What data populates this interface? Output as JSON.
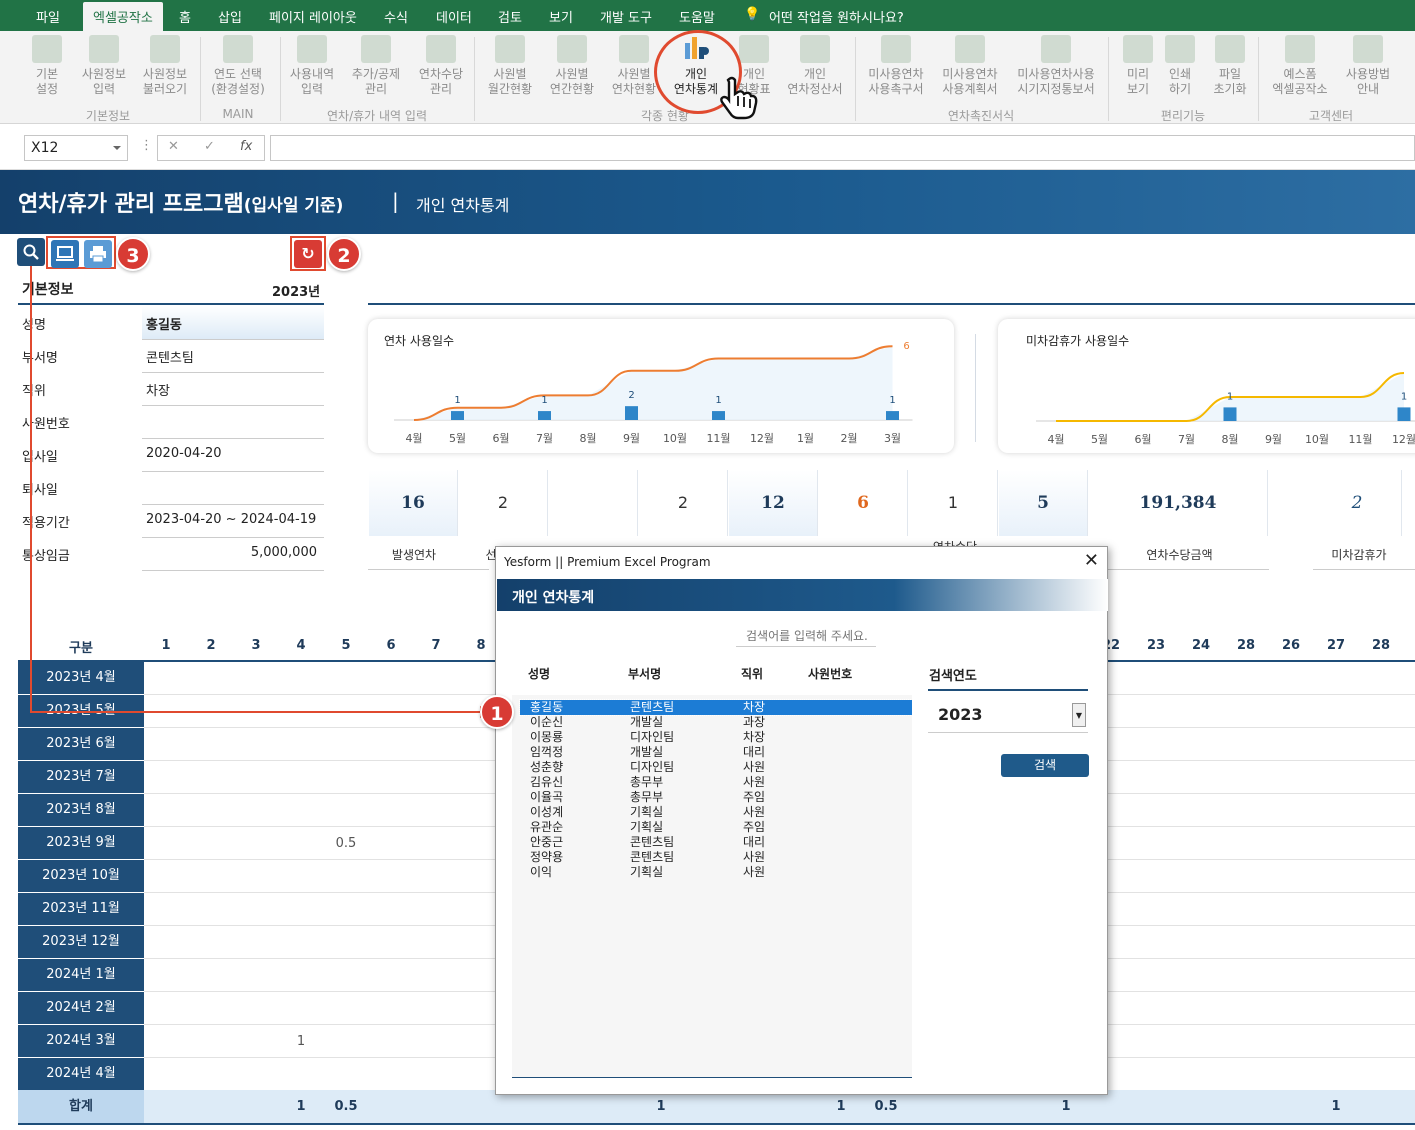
{
  "menu": {
    "tabs": [
      "파일",
      "엑셀공작소",
      "홈",
      "삽입",
      "페이지 레이아웃",
      "수식",
      "데이터",
      "검토",
      "보기",
      "개발 도구",
      "도움말"
    ],
    "tell_me": "어떤 작업을 원하시나요?"
  },
  "ribbon": {
    "buttons": [
      {
        "label": "기본\n설정",
        "icon": "gear-icon"
      },
      {
        "label": "사원정보\n입력",
        "icon": "users-icon"
      },
      {
        "label": "사원정보\n불러오기",
        "icon": "import-icon"
      },
      {
        "label": "연도 선택\n(환경설정)",
        "icon": "grid-icon"
      },
      {
        "label": "사용내역\n입력",
        "icon": "edit-list-icon"
      },
      {
        "label": "추가/공제\n관리",
        "icon": "list-edit-icon"
      },
      {
        "label": "연차수당\n관리",
        "icon": "list-edit-icon"
      },
      {
        "label": "사원별\n월간현황",
        "icon": "table-icon"
      },
      {
        "label": "사원별\n연간현황",
        "icon": "table-icon"
      },
      {
        "label": "사원별\n연차현황",
        "icon": "table-plus-icon"
      },
      {
        "label": "개인\n연차통계",
        "icon": "chart-user-icon"
      },
      {
        "label": "개인\n현황표",
        "icon": "table-check-icon"
      },
      {
        "label": "개인\n연차정산서",
        "icon": "card-icon"
      },
      {
        "label": "미사용연차\n사용촉구서",
        "icon": "clipboard-icon"
      },
      {
        "label": "미사용연차\n사용계획서",
        "icon": "clipboard-icon"
      },
      {
        "label": "미사용연차사용\n시기지정통보서",
        "icon": "clipboard-icon"
      },
      {
        "label": "미리\n보기",
        "icon": "preview-icon"
      },
      {
        "label": "인쇄\n하기",
        "icon": "printer-icon"
      },
      {
        "label": "파일\n초기화",
        "icon": "trash-icon"
      },
      {
        "label": "예스폼\n엑셀공작소",
        "icon": "logo-icon"
      },
      {
        "label": "사용방법\n안내",
        "icon": "info-icon"
      }
    ],
    "groups": [
      "기본정보",
      "MAIN",
      "연차/휴가 내역 입력",
      "각종 현황",
      "연차촉진서식",
      "편리기능",
      "고객센터"
    ]
  },
  "formula_bar": {
    "name_box": "X12",
    "fx": "fx"
  },
  "header": {
    "title": "연차/휴가 관리 프로그램",
    "subtitle": "(입사일 기준)",
    "sep": "|",
    "page": "개인 연차통계"
  },
  "badges": [
    "1",
    "2",
    "3"
  ],
  "basic_info": {
    "title": "기본정보",
    "year": "2023년",
    "rows": [
      {
        "label": "성명",
        "value": "홍길동"
      },
      {
        "label": "부서명",
        "value": "콘텐츠팀"
      },
      {
        "label": "직위",
        "value": "차장"
      },
      {
        "label": "사원번호",
        "value": ""
      },
      {
        "label": "입사일",
        "value": "2020-04-20"
      },
      {
        "label": "퇴사일",
        "value": ""
      },
      {
        "label": "적용기간",
        "value": "2023-04-20 ~ 2024-04-19"
      },
      {
        "label": "통상임금",
        "value": "5,000,000"
      }
    ]
  },
  "chart_data": [
    {
      "type": "line",
      "title": "연차 사용일수",
      "categories": [
        "4월",
        "5월",
        "6월",
        "7월",
        "8월",
        "9월",
        "10월",
        "11월",
        "12월",
        "1월",
        "2월",
        "3월"
      ],
      "series": [
        {
          "values": [
            0,
            1,
            0,
            1,
            0,
            2,
            0,
            1,
            0,
            0,
            0,
            1
          ]
        },
        {
          "values": [
            0,
            1,
            1,
            2,
            2,
            4,
            4,
            5,
            5,
            5,
            5,
            6
          ]
        }
      ],
      "point_labels": [
        "",
        "1",
        "",
        "1",
        "",
        "2",
        "",
        "1",
        "",
        "",
        "",
        "1"
      ],
      "end_label": "6",
      "colors": {
        "bar": "#2e86c9",
        "line": "#ed7d31"
      }
    },
    {
      "type": "line",
      "title": "미차감휴가 사용일수",
      "categories": [
        "4월",
        "5월",
        "6월",
        "7월",
        "8월",
        "9월",
        "10월",
        "11월",
        "12월"
      ],
      "series": [
        {
          "values": [
            0,
            0,
            0,
            0,
            1,
            0,
            0,
            0,
            1
          ]
        },
        {
          "values": [
            0,
            0,
            0,
            0,
            1,
            1,
            1,
            1,
            2
          ]
        }
      ],
      "point_labels": [
        "",
        "",
        "",
        "",
        "1",
        "",
        "",
        "",
        "1"
      ],
      "colors": {
        "bar": "#2e86c9",
        "line": "#f5b800"
      }
    }
  ],
  "stats": {
    "values": [
      "16",
      "2",
      "",
      "2",
      "12",
      "6",
      "1",
      "5",
      "191,384",
      "2"
    ],
    "labels": [
      "발생연차",
      "선",
      "연차수당",
      "연차수당금액",
      "미차감휴가"
    ]
  },
  "grid": {
    "header": "구분",
    "days_left": [
      "1",
      "2",
      "3",
      "4",
      "5",
      "6",
      "7",
      "8"
    ],
    "days_right": [
      "22",
      "23",
      "24",
      "28",
      "26",
      "27",
      "28"
    ],
    "months": [
      "2023년 4월",
      "2023년 5월",
      "2023년 6월",
      "2023년 7월",
      "2023년 8월",
      "2023년 9월",
      "2023년 10월",
      "2023년 11월",
      "2023년 12월",
      "2024년 1월",
      "2024년 2월",
      "2024년 3월",
      "2024년 4월"
    ],
    "cells": [
      {
        "row": 5,
        "col": 5,
        "value": "0.5"
      },
      {
        "row": 11,
        "col": 4,
        "value": "1"
      }
    ],
    "total_label": "합계",
    "totals": [
      {
        "x": 301,
        "value": "1"
      },
      {
        "x": 346,
        "value": "0.5"
      },
      {
        "x": 661,
        "value": "1"
      },
      {
        "x": 841,
        "value": "1"
      },
      {
        "x": 886,
        "value": "0.5"
      },
      {
        "x": 1066,
        "value": "1"
      },
      {
        "x": 1336,
        "value": "1"
      }
    ]
  },
  "dialog": {
    "window_title": "Yesform  ||  Premium Excel Program",
    "close": "✕",
    "heading": "개인 연차통계",
    "search_placeholder": "검색어를 입력해 주세요.",
    "columns": [
      "성명",
      "부서명",
      "직위",
      "사원번호"
    ],
    "rows": [
      [
        "홍길동",
        "콘텐츠팀",
        "차장"
      ],
      [
        "이순신",
        "개발실",
        "과장"
      ],
      [
        "이몽룡",
        "디자인팀",
        "차장"
      ],
      [
        "임꺽정",
        "개발실",
        "대리"
      ],
      [
        "성춘향",
        "디자인팀",
        "사원"
      ],
      [
        "김유신",
        "총무부",
        "사원"
      ],
      [
        "이율곡",
        "총무부",
        "주임"
      ],
      [
        "이성계",
        "기획실",
        "사원"
      ],
      [
        "유관순",
        "기획실",
        "주임"
      ],
      [
        "안중근",
        "콘텐츠팀",
        "대리"
      ],
      [
        "정약용",
        "콘텐츠팀",
        "사원"
      ],
      [
        "이익",
        "기획실",
        "사원"
      ]
    ],
    "year_label": "검색연도",
    "year_value": "2023",
    "search_button": "검색"
  }
}
